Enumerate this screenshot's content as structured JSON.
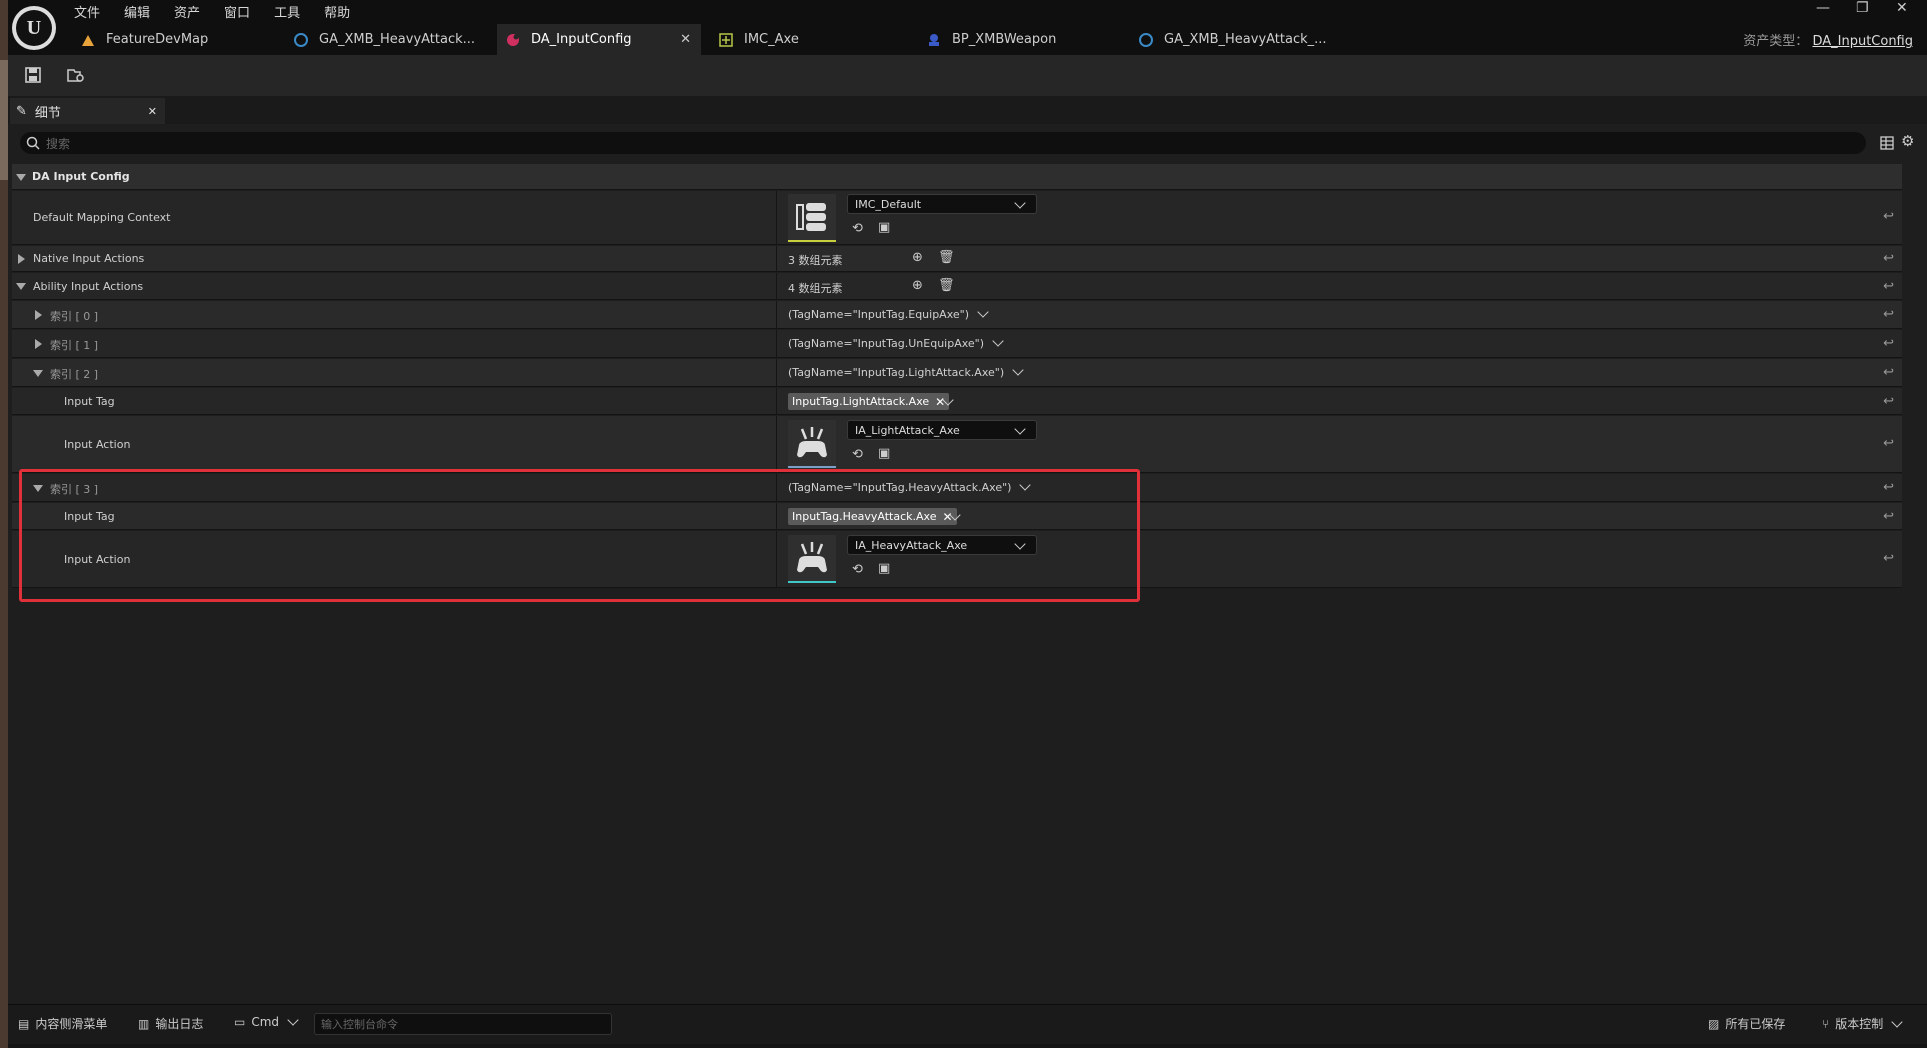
{
  "menu": [
    "文件",
    "编辑",
    "资产",
    "窗口",
    "工具",
    "帮助"
  ],
  "tabs": [
    {
      "label": "FeatureDevMap",
      "icon": "level-icon"
    },
    {
      "label": "GA_XMB_HeavyAttack...",
      "icon": "blueprint-icon"
    },
    {
      "label": "DA_InputConfig",
      "icon": "data-asset-icon"
    },
    {
      "label": "IMC_Axe",
      "icon": "mapping-context-icon"
    },
    {
      "label": "BP_XMBWeapon",
      "icon": "blueprint-icon"
    },
    {
      "label": "GA_XMB_HeavyAttack_...",
      "icon": "blueprint-icon"
    }
  ],
  "asset_type": {
    "label": "资产类型：",
    "value": "DA_InputConfig"
  },
  "details": {
    "tab_label": "细节",
    "search_placeholder": "搜索",
    "category": "DA Input Config",
    "default_mapping_context": {
      "label": "Default Mapping Context",
      "value": "IMC_Default"
    },
    "native_input_actions": {
      "label": "Native Input Actions",
      "count": "3 数组元素"
    },
    "ability_input_actions": {
      "label": "Ability Input Actions",
      "count": "4 数组元素"
    },
    "elements": [
      {
        "label": "索引 [ 0 ]",
        "summary": "(TagName=\"InputTag.EquipAxe\")"
      },
      {
        "label": "索引 [ 1 ]",
        "summary": "(TagName=\"InputTag.UnEquipAxe\")"
      },
      {
        "label": "索引 [ 2 ]",
        "summary": "(TagName=\"InputTag.LightAttack.Axe\")",
        "input_tag_label": "Input Tag",
        "input_tag": "InputTag.LightAttack.Axe",
        "input_action_label": "Input Action",
        "input_action": "IA_LightAttack_Axe"
      },
      {
        "label": "索引 [ 3 ]",
        "summary": "(TagName=\"InputTag.HeavyAttack.Axe\")",
        "input_tag_label": "Input Tag",
        "input_tag": "InputTag.HeavyAttack.Axe",
        "input_action_label": "Input Action",
        "input_action": "IA_HeavyAttack_Axe"
      }
    ]
  },
  "statusbar": {
    "content_drawer": "内容侧滑菜单",
    "output_log": "输出日志",
    "cmd": "Cmd",
    "console_placeholder": "输入控制台命令",
    "all_saved": "所有已保存",
    "source_control": "版本控制"
  },
  "colors": {
    "highlight": "#e0303a",
    "active_tab_icon": "#d03060"
  }
}
